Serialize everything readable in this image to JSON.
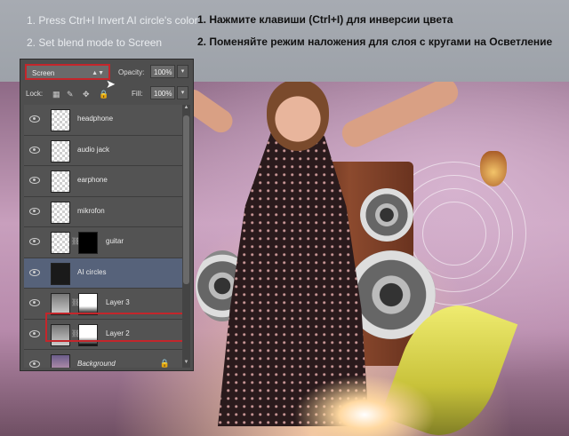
{
  "instructions": {
    "en_step1": "1. Press Ctrl+I Invert AI circle's color",
    "en_step2": "2. Set blend mode to Screen",
    "ru_step1": "1. Нажмите клавиши (Ctrl+I) для инверсии цвета",
    "ru_step2": "2. Поменяйте режим наложения для слоя с кругами на Осветление"
  },
  "layers_panel": {
    "blend_mode": "Screen",
    "opacity_label": "Opacity:",
    "opacity_value": "100%",
    "lock_label": "Lock:",
    "fill_label": "Fill:",
    "fill_value": "100%",
    "layers": [
      {
        "name": "headphone"
      },
      {
        "name": "audio jack"
      },
      {
        "name": "earphone"
      },
      {
        "name": "mikrofon"
      },
      {
        "name": "guitar"
      },
      {
        "name": "AI circles",
        "selected": true
      },
      {
        "name": "Layer 3"
      },
      {
        "name": "Layer 2"
      },
      {
        "name": "Background",
        "locked": true
      }
    ]
  },
  "colors": {
    "highlight_red": "#c4262b",
    "panel_bg": "#4e4e4e",
    "selected_row": "#56627a"
  }
}
